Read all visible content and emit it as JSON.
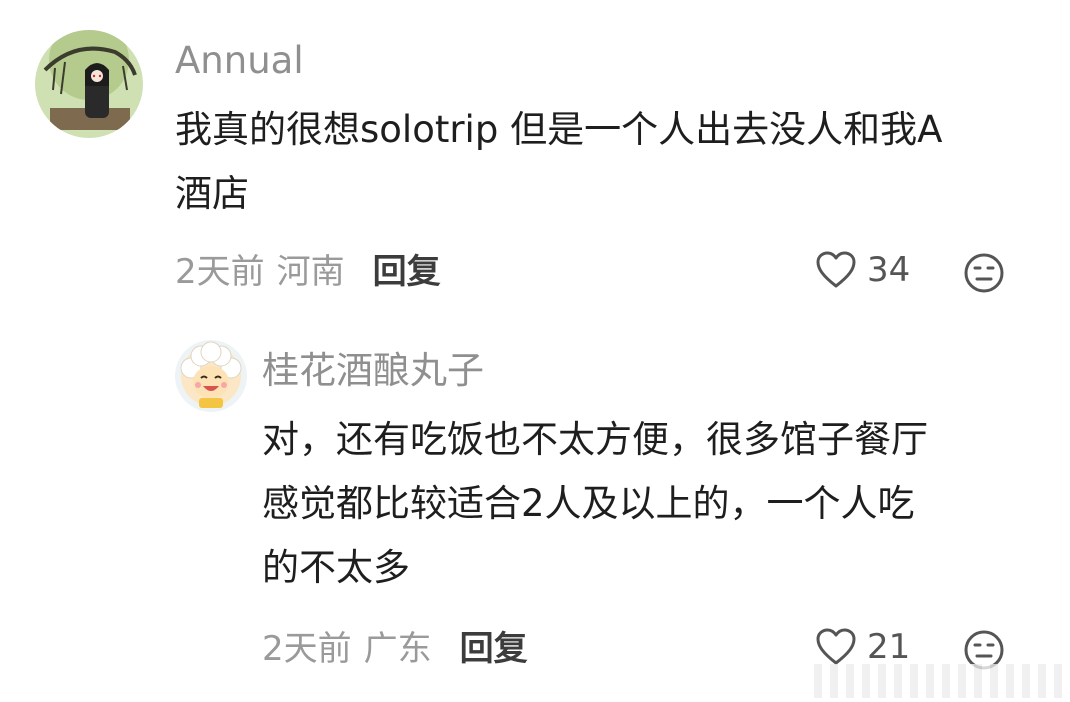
{
  "comments": [
    {
      "username": "Annual",
      "text_line1": "我真的很想solotrip 但是一个人出去没人和我A",
      "text_line2": "酒店",
      "time": "2天前",
      "region": "河南",
      "reply_label": "回复",
      "likes": "34"
    },
    {
      "username": "桂花酒酿丸子",
      "text_line1": "对，还有吃饭也不太方便，很多馆子餐厅",
      "text_line2": "感觉都比较适合2人及以上的，一个人吃",
      "text_line3": "的不太多",
      "time": "2天前",
      "region": "广东",
      "reply_label": "回复",
      "likes": "21"
    }
  ],
  "icons": {
    "like": "heart-outline-icon",
    "dislike": "meh-face-icon"
  },
  "colors": {
    "username": "#8f8f8f",
    "meta": "#9a9a9a",
    "text": "#1e1e1e"
  }
}
